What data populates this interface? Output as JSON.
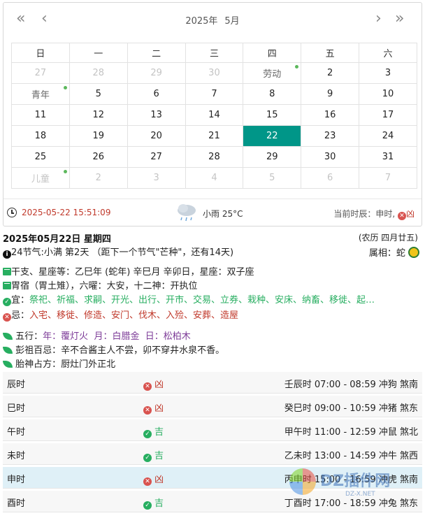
{
  "header": {
    "prev_year": "«",
    "prev_month": "‹",
    "next_month": "›",
    "next_year": "»",
    "year": "2025年",
    "month": "5月"
  },
  "weekdays": [
    "日",
    "一",
    "二",
    "三",
    "四",
    "五",
    "六"
  ],
  "weeks": [
    [
      {
        "t": "27",
        "s": "muted"
      },
      {
        "t": "28",
        "s": "muted"
      },
      {
        "t": "29",
        "s": "muted"
      },
      {
        "t": "30",
        "s": "muted"
      },
      {
        "t": "劳动",
        "s": "fest",
        "dot": true
      },
      {
        "t": "2"
      },
      {
        "t": "3"
      }
    ],
    [
      {
        "t": "青年",
        "s": "fest",
        "dot": true
      },
      {
        "t": "5"
      },
      {
        "t": "6"
      },
      {
        "t": "7"
      },
      {
        "t": "8"
      },
      {
        "t": "9"
      },
      {
        "t": "10"
      }
    ],
    [
      {
        "t": "11"
      },
      {
        "t": "12"
      },
      {
        "t": "13"
      },
      {
        "t": "14"
      },
      {
        "t": "15"
      },
      {
        "t": "16"
      },
      {
        "t": "17"
      }
    ],
    [
      {
        "t": "18"
      },
      {
        "t": "19"
      },
      {
        "t": "20"
      },
      {
        "t": "21"
      },
      {
        "t": "22",
        "s": "today"
      },
      {
        "t": "23"
      },
      {
        "t": "24"
      }
    ],
    [
      {
        "t": "25"
      },
      {
        "t": "26"
      },
      {
        "t": "27"
      },
      {
        "t": "28"
      },
      {
        "t": "29"
      },
      {
        "t": "30"
      },
      {
        "t": "31"
      }
    ],
    [
      {
        "t": "儿童",
        "s": "muted",
        "dot": true
      },
      {
        "t": "2",
        "s": "muted"
      },
      {
        "t": "3",
        "s": "muted"
      },
      {
        "t": "4",
        "s": "muted"
      },
      {
        "t": "5",
        "s": "muted"
      },
      {
        "t": "6",
        "s": "muted"
      },
      {
        "t": "7",
        "s": "muted"
      }
    ]
  ],
  "footer": {
    "datetime": "2025-05-22 15:51:09",
    "weather": "小雨 25°C",
    "shichen_label": "当前时辰：申时,",
    "shichen_status": "凶"
  },
  "details": {
    "date_title": "2025年05月22日 星期四",
    "lunar": "(农历 四月廿五)",
    "solar_term": "24节气:小满 第2天 （距下一个节气\"芒种\"，还有14天)",
    "zodiac": "属相：蛇",
    "ganzhi": "干支、星座等：乙巳年 (蛇年) 辛巳月 辛卯日，星座：双子座",
    "xiu": "胃宿（胃土雉），六曜：大安，十二神：开执位",
    "yi_label": "宜：",
    "yi": "祭祀、祈福、求嗣、开光、出行、开市、交易、立券、栽种、安床、纳畜、移徙、起…",
    "ji_label": "忌：",
    "ji": "入宅、移徙、修造、安门、伐木、入殓、安葬、造屋",
    "wuxing_label": "五行：",
    "wuxing_year": "年：覆灯火",
    "wuxing_month": "月：白腊金",
    "wuxing_day": "日：松柏木",
    "pengzu": "彭祖百忌：辛不合酱主人不尝，卯不穿井水泉不香。",
    "taishen": "胎神占方：厨灶门外正北"
  },
  "hours": [
    {
      "name": "辰时",
      "status": "凶",
      "good": false,
      "detail": "壬辰时 07:00 - 08:59 冲狗 煞南"
    },
    {
      "name": "巳时",
      "status": "凶",
      "good": false,
      "detail": "癸巳时 09:00 - 10:59 冲猪 煞东"
    },
    {
      "name": "午时",
      "status": "吉",
      "good": true,
      "detail": "甲午时 11:00 - 12:59 冲鼠 煞北"
    },
    {
      "name": "未时",
      "status": "吉",
      "good": true,
      "detail": "乙未时 13:00 - 14:59 冲牛 煞西"
    },
    {
      "name": "申时",
      "status": "凶",
      "good": false,
      "detail": "丙申时 15:00 - 16:59 冲虎 煞南",
      "current": true
    },
    {
      "name": "酉时",
      "status": "吉",
      "good": true,
      "detail": "丁酉时 17:00 - 18:59 冲兔 煞东"
    }
  ],
  "watermark": {
    "text": "DZ插件网",
    "sub": "DZ-X.NET"
  }
}
